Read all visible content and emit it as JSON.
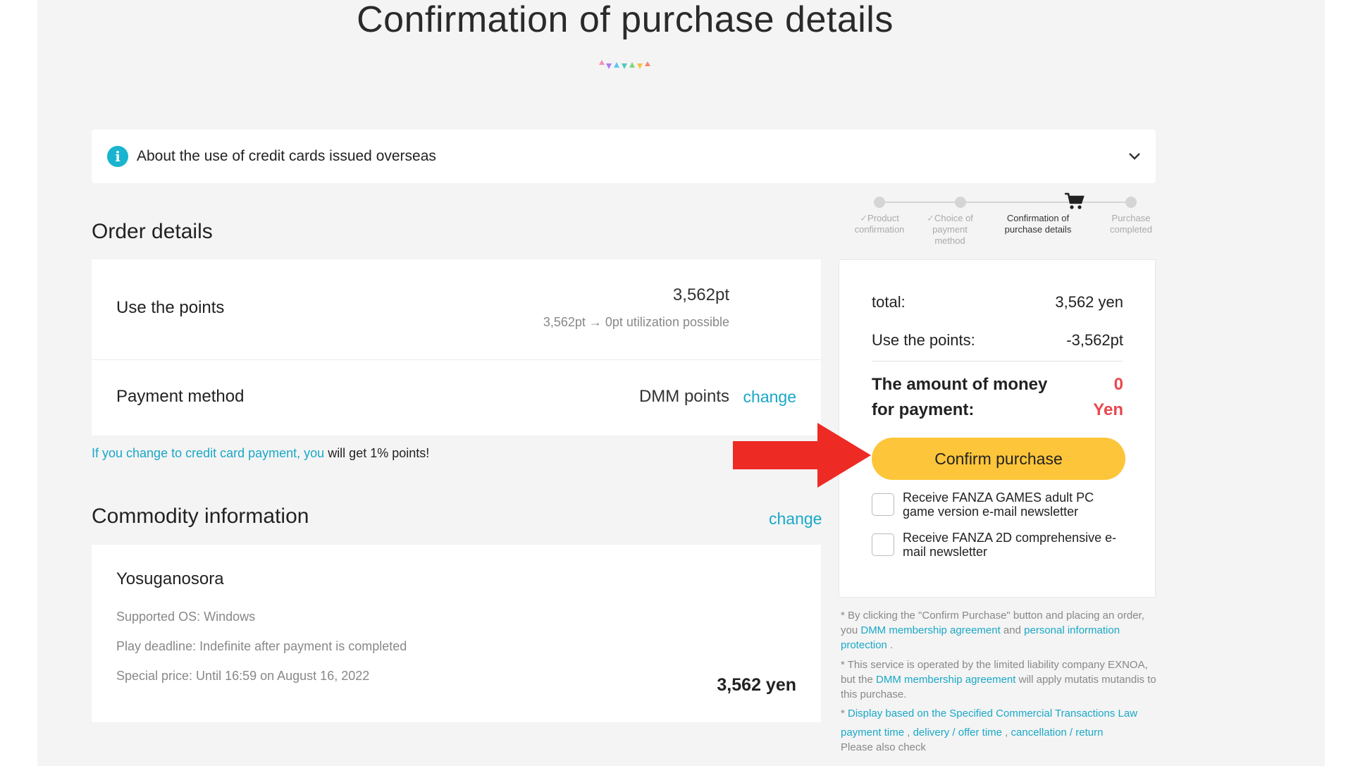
{
  "header": {
    "title": "Confirmation of purchase details"
  },
  "info_bar": {
    "text": "About the use of credit cards issued overseas"
  },
  "order": {
    "title": "Order details",
    "points": {
      "label": "Use the points",
      "value": "3,562pt",
      "sub": "3,562pt → 0pt utilization possible"
    },
    "payment": {
      "label": "Payment method",
      "value": "DMM points",
      "change": "change"
    },
    "note": {
      "link": "If you change to credit card payment, you",
      "text": " will get 1% points!"
    }
  },
  "commodity": {
    "title": "Commodity information",
    "change": "change",
    "name": "Yosuganosora",
    "os": "Supported OS: Windows",
    "deadline": "Play deadline: Indefinite after payment is completed",
    "special": "Special price: Until 16:59 on August 16, 2022",
    "price": "3,562 yen"
  },
  "steps": [
    {
      "label": "Product confirmation",
      "done": true
    },
    {
      "label": "Choice of payment method",
      "done": true
    },
    {
      "label": "Confirmation of purchase details",
      "active": true
    },
    {
      "label": "Purchase completed"
    }
  ],
  "steps_text": {
    "s1a": "Product",
    "s1b": "confirmation",
    "s2a": "Choice of",
    "s2b": "payment",
    "s2c": "method",
    "s3a": "Confirmation of",
    "s3b": "purchase details",
    "s4a": "Purchase",
    "s4b": "completed"
  },
  "summary": {
    "total_label": "total:",
    "total_value": "3,562 yen",
    "points_label": "Use the points:",
    "points_value": "-3,562pt",
    "pay_label_1": "The amount of money",
    "pay_label_2": "for payment:",
    "pay_value_1": "0",
    "pay_value_2": "Yen",
    "confirm_button": "Confirm purchase",
    "newsletter_1": "Receive FANZA GAMES adult PC game version e-mail newsletter",
    "newsletter_2": "Receive FANZA 2D comprehensive e-mail newsletter"
  },
  "legal": {
    "p1_a": "* By clicking the \"Confirm Purchase\" button and placing an order, you ",
    "p1_link1": "DMM membership agreement",
    "p1_b": " and ",
    "p1_link2": "personal information protection",
    "p1_c": " .",
    "p2_a": "* This service is operated by the limited liability company EXNOA, but the ",
    "p2_link": "DMM membership agreement",
    "p2_b": " will apply mutatis mutandis to this purchase.",
    "p3_star": "* ",
    "p3_link": "Display based on the Specified Commercial Transactions Law",
    "p4_link1": "payment time",
    "p4_sep1": " , ",
    "p4_link2": "delivery / offer time",
    "p4_sep2": " , ",
    "p4_link3": "cancellation / return",
    "p5": "Please also check"
  },
  "colors": {
    "accent": "#19a8c7",
    "button": "#fdc53a",
    "price_red": "#e8484f",
    "arrow": "#ee2a24"
  }
}
